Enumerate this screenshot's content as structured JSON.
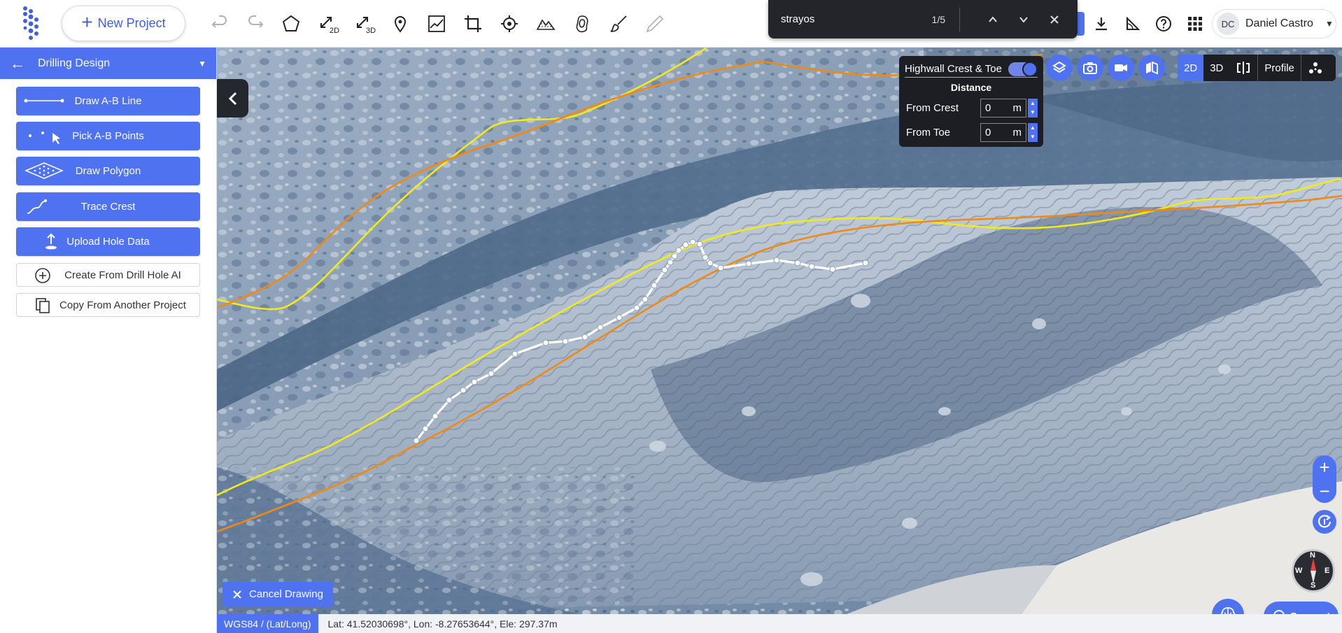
{
  "topbar": {
    "new_project_label": "New Project",
    "tools": [
      {
        "name": "undo-icon"
      },
      {
        "name": "redo-icon"
      },
      {
        "name": "polygon-icon"
      },
      {
        "name": "measure-2d-icon"
      },
      {
        "name": "measure-3d-icon"
      },
      {
        "name": "location-pin-icon"
      },
      {
        "name": "profile-chart-icon"
      },
      {
        "name": "crop-icon"
      },
      {
        "name": "target-icon"
      },
      {
        "name": "volume-icon"
      },
      {
        "name": "contour-icon"
      },
      {
        "name": "brush-icon"
      },
      {
        "name": "pen-icon"
      }
    ],
    "label_2d": "2D",
    "label_3d": "3D"
  },
  "findbar": {
    "query": "strayos",
    "count": "1/5"
  },
  "user": {
    "initials": "DC",
    "name": "Daniel Castro"
  },
  "sidebar": {
    "title": "Drilling Design",
    "buttons": [
      {
        "label": "Draw A-B Line"
      },
      {
        "label": "Pick A-B Points"
      },
      {
        "label": "Draw Polygon"
      },
      {
        "label": "Trace Crest"
      },
      {
        "label": "Upload Hole Data"
      }
    ],
    "outline_buttons": [
      {
        "label": "Create From Drill Hole AI"
      },
      {
        "label": "Copy From Another Project"
      }
    ]
  },
  "highwall": {
    "title": "Highwall Crest & Toe",
    "enabled": true,
    "distance_heading": "Distance",
    "from_crest_label": "From Crest",
    "from_crest_value": "0",
    "from_toe_label": "From Toe",
    "from_toe_value": "0",
    "unit": "m"
  },
  "view_toggle": {
    "mode_2d": "2D",
    "mode_3d": "3D",
    "profile": "Profile",
    "active": "2D"
  },
  "compass": {
    "n": "N",
    "e": "E",
    "s": "S",
    "w": "W"
  },
  "cancel_label": "Cancel Drawing",
  "support_label": "Support",
  "status": {
    "crs": "WGS84 / (Lat/Long)",
    "coords": "Lat: 41.52030698°, Lon: -8.27653644°, Ele: 297.37m"
  },
  "colors": {
    "accent": "#4f73f0",
    "crest_line": "#f2ea1c",
    "toe_line": "#f08a12",
    "trace_line": "#ffffff"
  }
}
